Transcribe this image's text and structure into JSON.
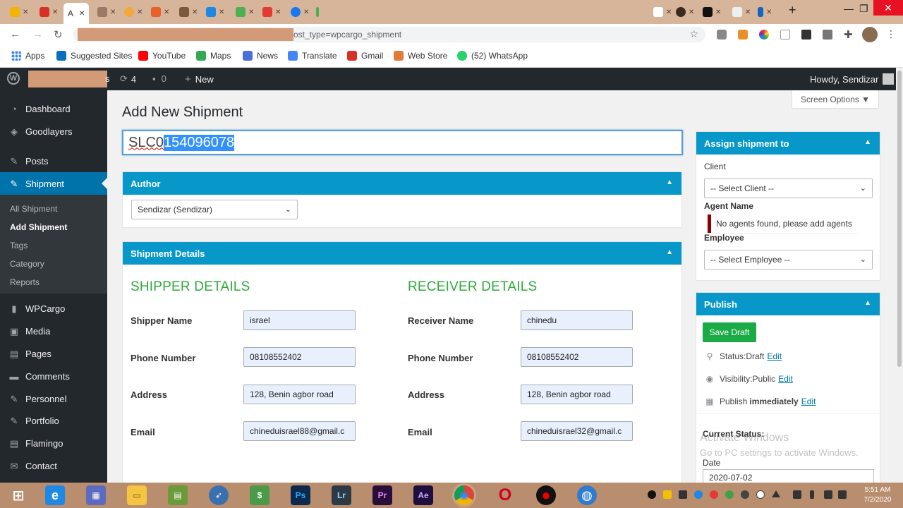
{
  "browser": {
    "active_tab_label": "A",
    "url_visible": "ost_type=wpcargo_shipment",
    "bookmarks": [
      {
        "label": "Apps",
        "color": "#4285f4"
      },
      {
        "label": "Suggested Sites",
        "color": "#0a6ebd"
      },
      {
        "label": "YouTube",
        "color": "#ff0000"
      },
      {
        "label": "Maps",
        "color": "#34a853"
      },
      {
        "label": "News",
        "color": "#4a6fd6"
      },
      {
        "label": "Translate",
        "color": "#4285f4"
      },
      {
        "label": "Gmail",
        "color": "#d93025"
      },
      {
        "label": "Web Store",
        "color": "#e07b39"
      },
      {
        "label": "(52) WhatsApp",
        "color": "#25d366"
      }
    ]
  },
  "adminbar": {
    "updates_count": "4",
    "comments_count": "0",
    "new_label": "New",
    "howdy": "Howdy, Sendizar",
    "site_suffix": "s"
  },
  "sidebar": {
    "items": [
      {
        "label": "Dashboard",
        "icon": "dashboard-icon",
        "glyph": "◔"
      },
      {
        "label": "Goodlayers",
        "icon": "layers-icon",
        "glyph": "◈"
      },
      {
        "label": "Posts",
        "icon": "pin-icon",
        "glyph": "✎"
      },
      {
        "label": "Shipment",
        "icon": "pin-icon",
        "glyph": "✎"
      },
      {
        "label": "WPCargo",
        "icon": "cargo-icon",
        "glyph": "▮"
      },
      {
        "label": "Media",
        "icon": "media-icon",
        "glyph": "▣"
      },
      {
        "label": "Pages",
        "icon": "pages-icon",
        "glyph": "▤"
      },
      {
        "label": "Comments",
        "icon": "comments-icon",
        "glyph": "▬"
      },
      {
        "label": "Personnel",
        "icon": "pin-icon",
        "glyph": "✎"
      },
      {
        "label": "Portfolio",
        "icon": "pin-icon",
        "glyph": "✎"
      },
      {
        "label": "Flamingo",
        "icon": "flamingo-icon",
        "glyph": "▤"
      },
      {
        "label": "Contact",
        "icon": "mail-icon",
        "glyph": "✉"
      }
    ],
    "submenu": [
      "All Shipment",
      "Add Shipment",
      "Tags",
      "Category",
      "Reports"
    ]
  },
  "main": {
    "screen_options": "Screen Options ▼",
    "page_title": "Add New Shipment",
    "title_prefix": "SLC0",
    "title_selected": "154096078",
    "author_box_title": "Author",
    "author_value": "Sendizar (Sendizar)",
    "details_box_title": "Shipment Details",
    "shipper_heading": "SHIPPER DETAILS",
    "receiver_heading": "RECEIVER DETAILS",
    "shipper": {
      "name_label": "Shipper Name",
      "name": "israel",
      "phone_label": "Phone Number",
      "phone": "08108552402",
      "address_label": "Address",
      "address": "128, Benin agbor road",
      "email_label": "Email",
      "email": "chineduisrael88@gmail.c"
    },
    "receiver": {
      "name_label": "Receiver Name",
      "name": "chinedu",
      "phone_label": "Phone Number",
      "phone": "08108552402",
      "address_label": "Address",
      "address": "128, Benin agbor road",
      "email_label": "Email",
      "email": "chineduisrael32@gmail.c"
    }
  },
  "assign": {
    "title": "Assign shipment to",
    "client_label": "Client",
    "client_select": "-- Select Client --",
    "agent_label": "Agent Name",
    "agent_notice": "No agents found, please add agents",
    "employee_label": "Employee",
    "employee_select": "-- Select Employee --"
  },
  "publish": {
    "title": "Publish",
    "save_draft": "Save Draft",
    "status_text": "Status: ",
    "status_value": "Draft",
    "visibility_text": "Visibility: ",
    "visibility_value": "Public",
    "publish_text": "Publish ",
    "publish_value": "immediately",
    "edit": "Edit",
    "current_status": "Current Status:",
    "date_label": "Date",
    "date_value": "2020-07-02"
  },
  "watermark": {
    "line1": "Activate Windows",
    "line2": "Go to PC settings to activate Windows."
  },
  "taskbar": {
    "apps": [
      {
        "name": "windows-start-icon",
        "label": "⊞",
        "color": "#b88e6f"
      },
      {
        "name": "internet-explorer-icon",
        "label": "e",
        "color": "#1e88e5"
      },
      {
        "name": "calculator-icon",
        "label": "▦",
        "color": "#5c6bc0"
      },
      {
        "name": "file-explorer-icon",
        "label": "▭",
        "color": "#f5c542"
      },
      {
        "name": "project-icon",
        "label": "▤",
        "color": "#6b9a3a"
      },
      {
        "name": "bird-app-icon",
        "label": "➶",
        "color": "#3a6fb0"
      },
      {
        "name": "money-app-icon",
        "label": "$",
        "color": "#4a9a4a"
      },
      {
        "name": "photoshop-icon",
        "label": "Ps",
        "color": "#0b2a4d"
      },
      {
        "name": "lightroom-icon",
        "label": "Lr",
        "color": "#2b3a44"
      },
      {
        "name": "premiere-icon",
        "label": "Pr",
        "color": "#2a0e3a"
      },
      {
        "name": "after-effects-icon",
        "label": "Ae",
        "color": "#1f0f3f"
      },
      {
        "name": "chrome-icon",
        "label": "◉",
        "color": "#db4437"
      },
      {
        "name": "opera-icon",
        "label": "O",
        "color": "#d0021b"
      },
      {
        "name": "recorder-icon",
        "label": "●",
        "color": "#111111"
      },
      {
        "name": "globe-icon",
        "label": "◍",
        "color": "#2e7bcf"
      }
    ],
    "time": "5:51 AM",
    "date": "7/2/2020"
  },
  "colors": {
    "accent": "#0797c9",
    "wp_blue": "#0073aa",
    "green": "#2eaa3b",
    "admin_dark": "#23282d"
  }
}
